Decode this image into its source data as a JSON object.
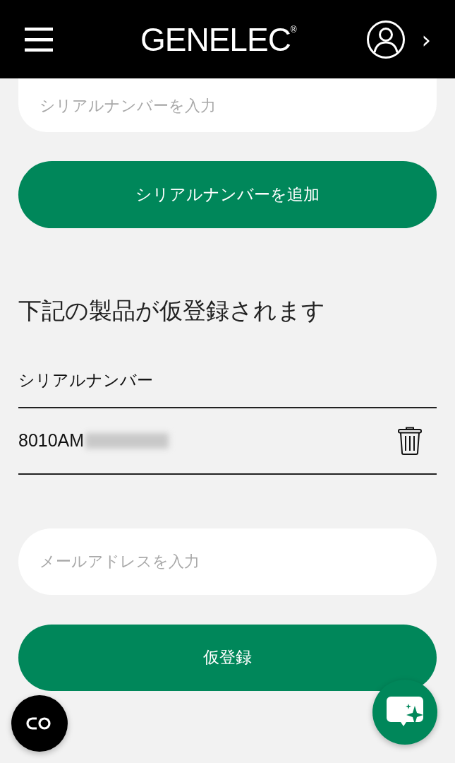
{
  "header": {
    "logo": "GENELEC$^{®}$",
    "chevron": "›"
  },
  "serial_input": {
    "placeholder": "シリアルナンバーを入力"
  },
  "add_button": "シリアルナンバーを追加",
  "heading": "下記の製品が仮登録されます",
  "table": {
    "column": "シリアルナンバー",
    "rows": [
      {
        "serial": "8010AM",
        "redacted": true
      }
    ]
  },
  "email_input": {
    "placeholder": "メールアドレスを入力"
  },
  "submit_button": "仮登録"
}
